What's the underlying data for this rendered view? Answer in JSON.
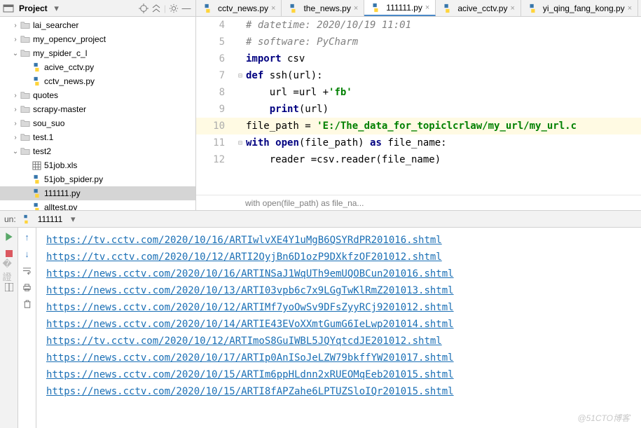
{
  "project": {
    "title": "Project",
    "items": [
      {
        "depth": 1,
        "arrow": ">",
        "kind": "folder",
        "label": "lai_searcher"
      },
      {
        "depth": 1,
        "arrow": ">",
        "kind": "folder",
        "label": "my_opencv_project"
      },
      {
        "depth": 1,
        "arrow": "v",
        "kind": "folder",
        "label": "my_spider_c_l"
      },
      {
        "depth": 2,
        "arrow": "",
        "kind": "py",
        "label": "acive_cctv.py"
      },
      {
        "depth": 2,
        "arrow": "",
        "kind": "py",
        "label": "cctv_news.py"
      },
      {
        "depth": 1,
        "arrow": ">",
        "kind": "folder",
        "label": "quotes"
      },
      {
        "depth": 1,
        "arrow": ">",
        "kind": "folder",
        "label": "scrapy-master"
      },
      {
        "depth": 1,
        "arrow": ">",
        "kind": "folder",
        "label": "sou_suo"
      },
      {
        "depth": 1,
        "arrow": ">",
        "kind": "folder",
        "label": "test.1"
      },
      {
        "depth": 1,
        "arrow": "v",
        "kind": "folder",
        "label": "test2"
      },
      {
        "depth": 2,
        "arrow": "",
        "kind": "xls",
        "label": "51job.xls"
      },
      {
        "depth": 2,
        "arrow": "",
        "kind": "py",
        "label": "51job_spider.py"
      },
      {
        "depth": 2,
        "arrow": "",
        "kind": "py",
        "label": "111111.py",
        "selected": true
      },
      {
        "depth": 2,
        "arrow": "",
        "kind": "py",
        "label": "alltest.py"
      }
    ]
  },
  "tabs": [
    {
      "label": "cctv_news.py",
      "active": false
    },
    {
      "label": "the_news.py",
      "active": false
    },
    {
      "label": "111111.py",
      "active": true
    },
    {
      "label": "acive_cctv.py",
      "active": false
    },
    {
      "label": "yi_qing_fang_kong.py",
      "active": false
    }
  ],
  "code": {
    "lines": [
      {
        "n": 4,
        "mark": "",
        "tokens": [
          [
            "c-comment",
            "# datetime: 2020/10/19 11:01"
          ]
        ]
      },
      {
        "n": 5,
        "mark": "",
        "tokens": [
          [
            "c-comment",
            "# software: PyCharm"
          ]
        ]
      },
      {
        "n": 6,
        "mark": "",
        "tokens": [
          [
            "c-kw",
            "import"
          ],
          [
            "",
            " csv"
          ]
        ]
      },
      {
        "n": 7,
        "mark": "-",
        "tokens": [
          [
            "c-kw",
            "def"
          ],
          [
            "",
            " "
          ],
          [
            "c-fn",
            "ssh"
          ],
          [
            "",
            "(url):"
          ]
        ]
      },
      {
        "n": 8,
        "mark": "",
        "tokens": [
          [
            "",
            "    url =url +"
          ],
          [
            "c-str",
            "'fb'"
          ]
        ]
      },
      {
        "n": 9,
        "mark": "",
        "tokens": [
          [
            "",
            "    "
          ],
          [
            "c-kw",
            "print"
          ],
          [
            "",
            "(url)"
          ]
        ]
      },
      {
        "n": 10,
        "mark": "",
        "hl": true,
        "tokens": [
          [
            "",
            "file_path = "
          ],
          [
            "c-str",
            "'E:/The_data_for_topiclcrlaw/my_url/my_url.c"
          ]
        ]
      },
      {
        "n": 11,
        "mark": "-",
        "tokens": [
          [
            "c-kw",
            "with"
          ],
          [
            "",
            " "
          ],
          [
            "c-kw",
            "open"
          ],
          [
            "",
            "(file_path) "
          ],
          [
            "c-kw",
            "as"
          ],
          [
            "",
            " file_name:"
          ]
        ]
      },
      {
        "n": 12,
        "mark": "",
        "tokens": [
          [
            "",
            "    reader =csv.reader(file_name)"
          ]
        ]
      }
    ],
    "breadcrumb": "with open(file_path) as file_na..."
  },
  "run": {
    "label": "un:",
    "config": "111111",
    "output": [
      "https://tv.cctv.com/2020/10/16/ARTIwlvXE4Y1uMgB6QSYRdPR201016.shtml",
      "https://tv.cctv.com/2020/10/12/ARTI2OyjBn6D1ozP9DXkfzOF201012.shtml",
      "https://news.cctv.com/2020/10/16/ARTINSaJ1WqUTh9emUQOBCun201016.shtml",
      "https://news.cctv.com/2020/10/13/ARTI03vpb6c7x9LGgTwKlRmZ201013.shtml",
      "https://news.cctv.com/2020/10/12/ARTIMf7yoOwSv9DFsZyyRCj9201012.shtml",
      "https://news.cctv.com/2020/10/14/ARTIE43EVoXXmtGumG6IeLwp201014.shtml",
      "https://tv.cctv.com/2020/10/12/ARTImoS8GuIWBL5JQYqtcdJE201012.shtml",
      "https://news.cctv.com/2020/10/17/ARTIp0AnISoJeLZW79bkffYW201017.shtml",
      "https://news.cctv.com/2020/10/15/ARTIm6ppHLdnn2xRUEOMqEeb201015.shtml",
      "https://news.cctv.com/2020/10/15/ARTI8fAPZahe6LPTUZSloIQr201015.shtml"
    ]
  },
  "watermark": "@51CTO博客"
}
